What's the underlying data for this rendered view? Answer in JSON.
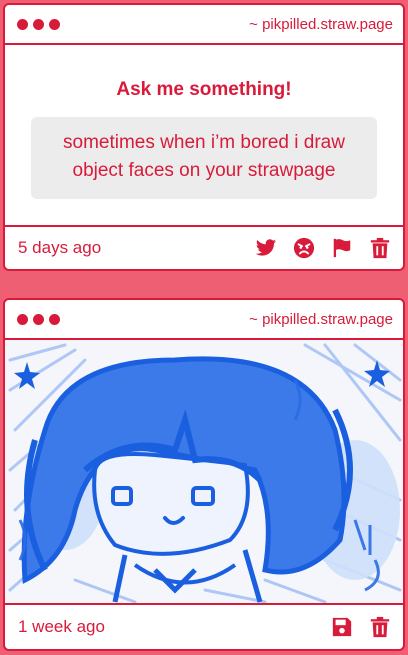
{
  "colors": {
    "accent": "#d81b3a",
    "background": "#ee5f73",
    "card": "#ffffff",
    "question_box": "#ececec",
    "drawing_blue": "#1a5fe0"
  },
  "posts": [
    {
      "site": "~ pikpilled.straw.page",
      "ask_title": "Ask me something!",
      "question": "sometimes when i’m bored i draw object faces on your strawpage",
      "timestamp": "5 days ago",
      "actions": [
        "twitter-icon",
        "angry-face-icon",
        "flag-icon",
        "trash-icon"
      ]
    },
    {
      "site": "~ pikpilled.straw.page",
      "drawing": "blue scribble drawing of a chibi character with bangs and stars",
      "timestamp": "1 week ago",
      "actions": [
        "save-icon",
        "trash-icon"
      ]
    }
  ]
}
